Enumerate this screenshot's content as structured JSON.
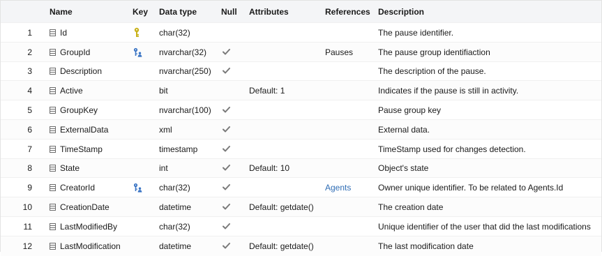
{
  "header": {
    "name": "Name",
    "key": "Key",
    "type": "Data type",
    "null": "Null",
    "attributes": "Attributes",
    "references": "References",
    "description": "Description"
  },
  "colors": {
    "primary_key": "#c9b21a",
    "foreign_key": "#3a74c4",
    "link": "#2f6db5",
    "check": "#7a7a7a"
  },
  "rows": [
    {
      "index": "1",
      "name": "Id",
      "key": "primary-key-icon",
      "type": "char(32)",
      "nullable": false,
      "attributes": "",
      "references": "",
      "description": "The pause identifier."
    },
    {
      "index": "2",
      "name": "GroupId",
      "key": "foreign-key-icon",
      "type": "nvarchar(32)",
      "nullable": true,
      "attributes": "",
      "references": "Pauses",
      "description": "The pause group identifiaction"
    },
    {
      "index": "3",
      "name": "Description",
      "key": "",
      "type": "nvarchar(250)",
      "nullable": true,
      "attributes": "",
      "references": "",
      "description": "The description of the pause."
    },
    {
      "index": "4",
      "name": "Active",
      "key": "",
      "type": "bit",
      "nullable": false,
      "attributes": "Default: 1",
      "references": "",
      "description": "Indicates if the pause is still in activity."
    },
    {
      "index": "5",
      "name": "GroupKey",
      "key": "",
      "type": "nvarchar(100)",
      "nullable": true,
      "attributes": "",
      "references": "",
      "description": "Pause group key"
    },
    {
      "index": "6",
      "name": "ExternalData",
      "key": "",
      "type": "xml",
      "nullable": true,
      "attributes": "",
      "references": "",
      "description": "External data."
    },
    {
      "index": "7",
      "name": "TimeStamp",
      "key": "",
      "type": "timestamp",
      "nullable": true,
      "attributes": "",
      "references": "",
      "description": "TimeStamp used for changes detection."
    },
    {
      "index": "8",
      "name": "State",
      "key": "",
      "type": "int",
      "nullable": true,
      "attributes": "Default: 10",
      "references": "",
      "description": "Object's state"
    },
    {
      "index": "9",
      "name": "CreatorId",
      "key": "foreign-key-icon",
      "type": "char(32)",
      "nullable": true,
      "attributes": "",
      "references": "Agents",
      "description": "Owner unique identifier. To be related to Agents.Id"
    },
    {
      "index": "10",
      "name": "CreationDate",
      "key": "",
      "type": "datetime",
      "nullable": true,
      "attributes": "Default: getdate()",
      "references": "",
      "description": "The creation date"
    },
    {
      "index": "11",
      "name": "LastModifiedBy",
      "key": "",
      "type": "char(32)",
      "nullable": true,
      "attributes": "",
      "references": "",
      "description": "Unique identifier of the user that did the last modifications"
    },
    {
      "index": "12",
      "name": "LastModification",
      "key": "",
      "type": "datetime",
      "nullable": true,
      "attributes": "Default: getdate()",
      "references": "",
      "description": "The last modification date"
    }
  ]
}
